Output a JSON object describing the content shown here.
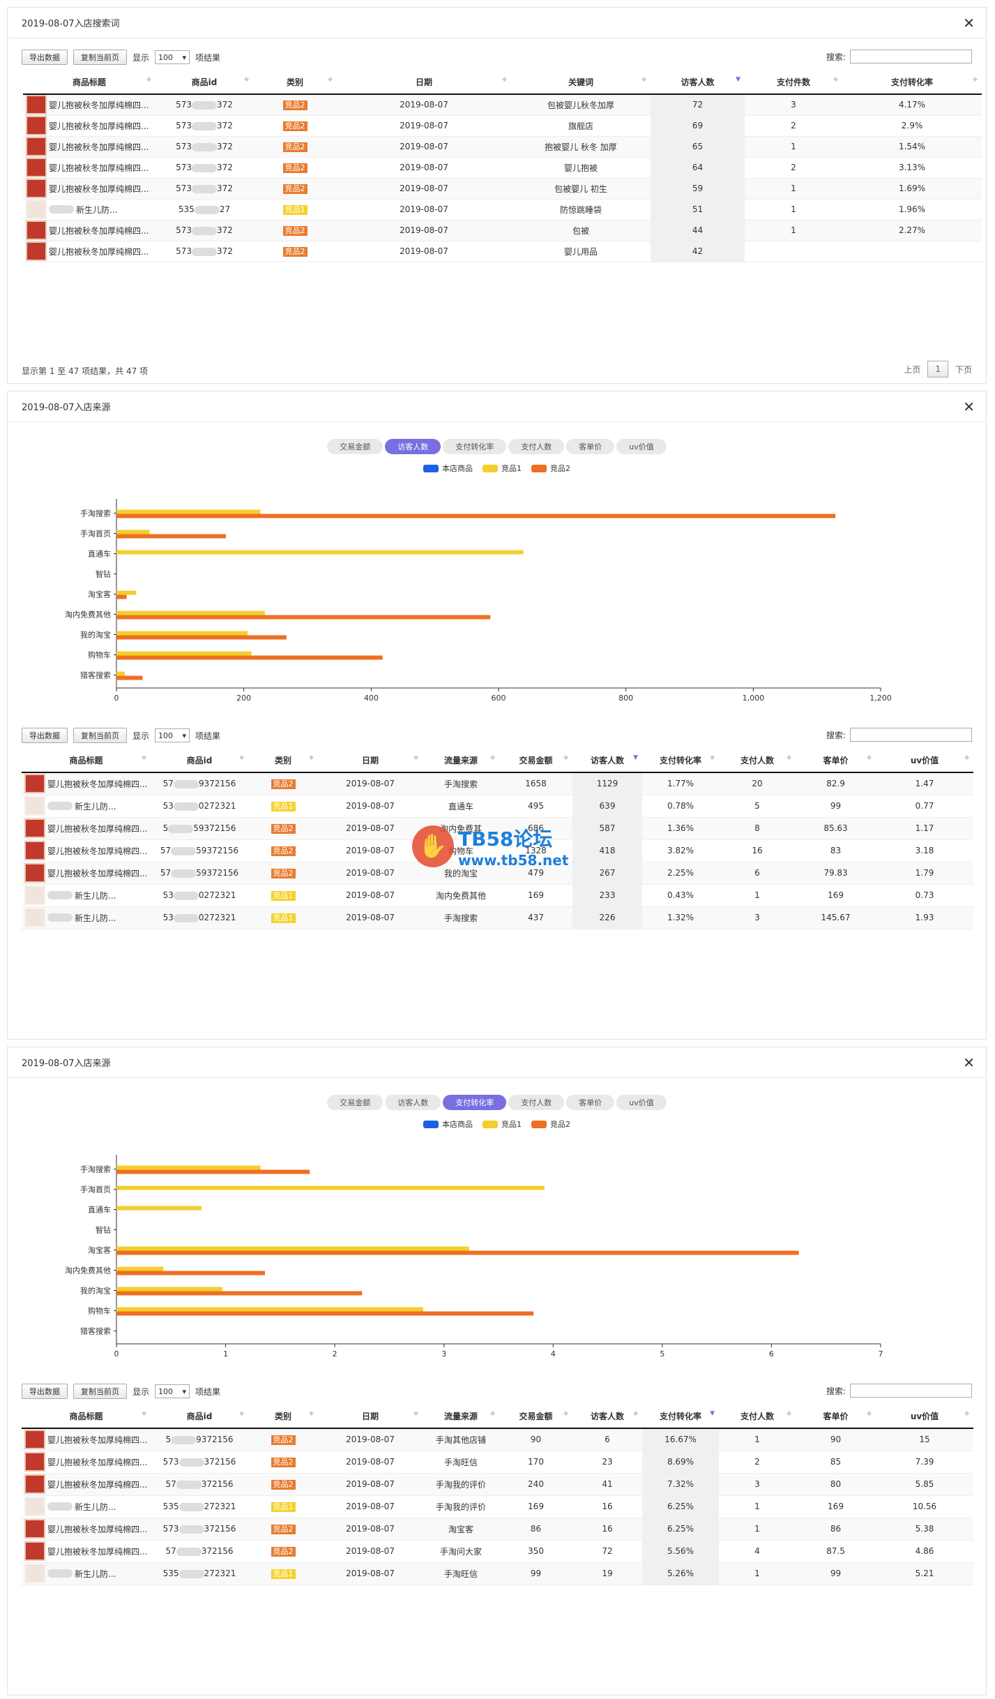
{
  "panel1": {
    "title": "2019-08-07入店搜索词",
    "export_btn": "导出数据",
    "copy_btn": "复制当前页",
    "show_label": "显示",
    "page_size": "100",
    "result_label": "项结果",
    "search_label": "搜索:",
    "headers": [
      "商品标题",
      "商品id",
      "类别",
      "日期",
      "关键词",
      "访客人数",
      "支付件数",
      "支付转化率"
    ],
    "rows": [
      {
        "thumb": "red",
        "title": "婴儿抱被秋冬加厚纯棉四...",
        "id": "573",
        "id2": "372",
        "cat": "竞品2",
        "cat_color": "o",
        "date": "2019-08-07",
        "kw": "包被婴儿秋冬加厚",
        "v": "72",
        "pay": "3",
        "cr": "4.17%"
      },
      {
        "thumb": "red",
        "title": "婴儿抱被秋冬加厚纯棉四...",
        "id": "573",
        "id2": "372",
        "cat": "竞品2",
        "cat_color": "o",
        "date": "2019-08-07",
        "kw": "旗舰店",
        "v": "69",
        "pay": "2",
        "cr": "2.9%"
      },
      {
        "thumb": "red",
        "title": "婴儿抱被秋冬加厚纯棉四...",
        "id": "573",
        "id2": "372",
        "cat": "竞品2",
        "cat_color": "o",
        "date": "2019-08-07",
        "kw": "抱被婴儿 秋冬 加厚",
        "v": "65",
        "pay": "1",
        "cr": "1.54%"
      },
      {
        "thumb": "red",
        "title": "婴儿抱被秋冬加厚纯棉四...",
        "id": "573",
        "id2": "372",
        "cat": "竞品2",
        "cat_color": "o",
        "date": "2019-08-07",
        "kw": "婴儿抱被",
        "v": "64",
        "pay": "2",
        "cr": "3.13%"
      },
      {
        "thumb": "red",
        "title": "婴儿抱被秋冬加厚纯棉四...",
        "id": "573",
        "id2": "372",
        "cat": "竞品2",
        "cat_color": "o",
        "date": "2019-08-07",
        "kw": "包被婴儿 初生",
        "v": "59",
        "pay": "1",
        "cr": "1.69%"
      },
      {
        "thumb": "beige",
        "title": "新生儿防...",
        "id": "535",
        "id2": "27",
        "cat": "竞品1",
        "cat_color": "y",
        "date": "2019-08-07",
        "kw": "防惊跳睡袋",
        "v": "51",
        "pay": "1",
        "cr": "1.96%"
      },
      {
        "thumb": "red",
        "title": "婴儿抱被秋冬加厚纯棉四...",
        "id": "573",
        "id2": "372",
        "cat": "竞品2",
        "cat_color": "o",
        "date": "2019-08-07",
        "kw": "包被",
        "v": "44",
        "pay": "1",
        "cr": "2.27%"
      },
      {
        "thumb": "red",
        "title": "婴儿抱被秋冬加厚纯棉四...",
        "id": "573",
        "id2": "372",
        "cat": "竞品2",
        "cat_color": "o",
        "date": "2019-08-07",
        "kw": "婴儿用品",
        "v": "42",
        "pay": "",
        "cr": ""
      }
    ],
    "footer": "显示第 1 至 47 项结果，共 47 项",
    "prev": "上页",
    "page": "1",
    "next": "下页"
  },
  "panel2": {
    "title": "2019-08-07入店来源",
    "tabs": [
      "交易金额",
      "访客人数",
      "支付转化率",
      "支付人数",
      "客单价",
      "uv价值"
    ],
    "active_tab": 1,
    "legend": [
      "本店商品",
      "竞品1",
      "竞品2"
    ],
    "export_btn": "导出数据",
    "copy_btn": "复制当前页",
    "show_label": "显示",
    "page_size": "100",
    "result_label": "项结果",
    "search_label": "搜索:",
    "headers": [
      "商品标题",
      "商品id",
      "类别",
      "日期",
      "流量来源",
      "交易金额",
      "访客人数",
      "支付转化率",
      "支付人数",
      "客单价",
      "uv价值"
    ],
    "rows": [
      {
        "thumb": "red",
        "title": "婴儿抱被秋冬加厚纯棉四...",
        "id": "57",
        "id2": "9372156",
        "cat": "竞品2",
        "cat_color": "o",
        "date": "2019-08-07",
        "src": "手淘搜索",
        "amt": "1658",
        "v": "1129",
        "cr": "1.77%",
        "pay": "20",
        "price": "82.9",
        "uv": "1.47"
      },
      {
        "thumb": "beige",
        "title": "新生儿防...",
        "id": "53",
        "id2": "0272321",
        "cat": "竞品1",
        "cat_color": "y",
        "date": "2019-08-07",
        "src": "直通车",
        "amt": "495",
        "v": "639",
        "cr": "0.78%",
        "pay": "5",
        "price": "99",
        "uv": "0.77"
      },
      {
        "thumb": "red",
        "title": "婴儿抱被秋冬加厚纯棉四...",
        "id": "5",
        "id2": "59372156",
        "cat": "竞品2",
        "cat_color": "o",
        "date": "2019-08-07",
        "src": "淘内免费其",
        "amt": "686",
        "v": "587",
        "cr": "1.36%",
        "pay": "8",
        "price": "85.63",
        "uv": "1.17"
      },
      {
        "thumb": "red",
        "title": "婴儿抱被秋冬加厚纯棉四...",
        "id": "57",
        "id2": "59372156",
        "cat": "竞品2",
        "cat_color": "o",
        "date": "2019-08-07",
        "src": "购物车",
        "amt": "1328",
        "v": "418",
        "cr": "3.82%",
        "pay": "16",
        "price": "83",
        "uv": "3.18"
      },
      {
        "thumb": "red",
        "title": "婴儿抱被秋冬加厚纯棉四...",
        "id": "57",
        "id2": "59372156",
        "cat": "竞品2",
        "cat_color": "o",
        "date": "2019-08-07",
        "src": "我的淘宝",
        "amt": "479",
        "v": "267",
        "cr": "2.25%",
        "pay": "6",
        "price": "79.83",
        "uv": "1.79"
      },
      {
        "thumb": "beige",
        "title": "新生儿防...",
        "id": "53",
        "id2": "0272321",
        "cat": "竞品1",
        "cat_color": "y",
        "date": "2019-08-07",
        "src": "淘内免费其他",
        "amt": "169",
        "v": "233",
        "cr": "0.43%",
        "pay": "1",
        "price": "169",
        "uv": "0.73"
      },
      {
        "thumb": "beige",
        "title": "新生儿防...",
        "id": "53",
        "id2": "0272321",
        "cat": "竞品1",
        "cat_color": "y",
        "date": "2019-08-07",
        "src": "手淘搜索",
        "amt": "437",
        "v": "226",
        "cr": "1.32%",
        "pay": "3",
        "price": "145.67",
        "uv": "1.93"
      }
    ],
    "watermark_1": "TB58论坛",
    "watermark_2": "www.tb58.net"
  },
  "panel3": {
    "title": "2019-08-07入店来源",
    "tabs": [
      "交易金额",
      "访客人数",
      "支付转化率",
      "支付人数",
      "客单价",
      "uv价值"
    ],
    "active_tab": 2,
    "legend": [
      "本店商品",
      "竞品1",
      "竞品2"
    ],
    "export_btn": "导出数据",
    "copy_btn": "复制当前页",
    "show_label": "显示",
    "page_size": "100",
    "result_label": "项结果",
    "search_label": "搜索:",
    "headers": [
      "商品标题",
      "商品id",
      "类别",
      "日期",
      "流量来源",
      "交易金额",
      "访客人数",
      "支付转化率",
      "支付人数",
      "客单价",
      "uv价值"
    ],
    "rows": [
      {
        "thumb": "red",
        "title": "婴儿抱被秋冬加厚纯棉四...",
        "id": "5",
        "id2": "9372156",
        "cat": "竞品2",
        "cat_color": "o",
        "date": "2019-08-07",
        "src": "手淘其他店铺",
        "amt": "90",
        "v": "6",
        "cr": "16.67%",
        "pay": "1",
        "price": "90",
        "uv": "15"
      },
      {
        "thumb": "red",
        "title": "婴儿抱被秋冬加厚纯棉四...",
        "id": "573",
        "id2": "372156",
        "cat": "竞品2",
        "cat_color": "o",
        "date": "2019-08-07",
        "src": "手淘旺信",
        "amt": "170",
        "v": "23",
        "cr": "8.69%",
        "pay": "2",
        "price": "85",
        "uv": "7.39"
      },
      {
        "thumb": "red",
        "title": "婴儿抱被秋冬加厚纯棉四...",
        "id": "57",
        "id2": "372156",
        "cat": "竞品2",
        "cat_color": "o",
        "date": "2019-08-07",
        "src": "手淘我的评价",
        "amt": "240",
        "v": "41",
        "cr": "7.32%",
        "pay": "3",
        "price": "80",
        "uv": "5.85"
      },
      {
        "thumb": "beige",
        "title": "新生儿防...",
        "id": "535",
        "id2": "272321",
        "cat": "竞品1",
        "cat_color": "y",
        "date": "2019-08-07",
        "src": "手淘我的评价",
        "amt": "169",
        "v": "16",
        "cr": "6.25%",
        "pay": "1",
        "price": "169",
        "uv": "10.56"
      },
      {
        "thumb": "red",
        "title": "婴儿抱被秋冬加厚纯棉四...",
        "id": "573",
        "id2": "372156",
        "cat": "竞品2",
        "cat_color": "o",
        "date": "2019-08-07",
        "src": "淘宝客",
        "amt": "86",
        "v": "16",
        "cr": "6.25%",
        "pay": "1",
        "price": "86",
        "uv": "5.38"
      },
      {
        "thumb": "red",
        "title": "婴儿抱被秋冬加厚纯棉四...",
        "id": "57",
        "id2": "372156",
        "cat": "竞品2",
        "cat_color": "o",
        "date": "2019-08-07",
        "src": "手淘问大家",
        "amt": "350",
        "v": "72",
        "cr": "5.56%",
        "pay": "4",
        "price": "87.5",
        "uv": "4.86"
      },
      {
        "thumb": "beige",
        "title": "新生儿防...",
        "id": "535",
        "id2": "272321",
        "cat": "竞品1",
        "cat_color": "y",
        "date": "2019-08-07",
        "src": "手淘旺信",
        "amt": "99",
        "v": "19",
        "cr": "5.26%",
        "pay": "1",
        "price": "99",
        "uv": "5.21"
      }
    ]
  },
  "colors": {
    "own": "#1f5fe0",
    "comp1": "#f2cf2c",
    "comp2": "#ee6f22",
    "active_tab": "#7a6fe0"
  },
  "chart_data": [
    {
      "type": "bar",
      "orientation": "horizontal",
      "categories": [
        "手淘搜索",
        "手淘首页",
        "直通车",
        "智钻",
        "淘宝客",
        "淘内免费其他",
        "我的淘宝",
        "购物车",
        "猎客搜索"
      ],
      "series": [
        {
          "name": "本店商品",
          "values": [
            0,
            0,
            0,
            0,
            0,
            0,
            0,
            0,
            0
          ]
        },
        {
          "name": "竞品1",
          "values": [
            226,
            52,
            639,
            0,
            31,
            233,
            206,
            212,
            13
          ]
        },
        {
          "name": "竞品2",
          "values": [
            1129,
            172,
            0,
            0,
            16,
            587,
            267,
            418,
            41
          ]
        }
      ],
      "xlim": [
        0,
        1200
      ],
      "ticks": [
        0,
        200,
        400,
        600,
        800,
        1000,
        1200
      ],
      "tick_labels": [
        "0",
        "200",
        "400",
        "600",
        "800",
        "1,000",
        "1,200"
      ]
    },
    {
      "type": "bar",
      "orientation": "horizontal",
      "categories": [
        "手淘搜索",
        "手淘首页",
        "直通车",
        "智钻",
        "淘宝客",
        "淘内免费其他",
        "我的淘宝",
        "购物车",
        "猎客搜索"
      ],
      "series": [
        {
          "name": "本店商品",
          "values": [
            0,
            0,
            0,
            0,
            0,
            0,
            0,
            0,
            0
          ]
        },
        {
          "name": "竞品1",
          "values": [
            1.32,
            3.92,
            0.78,
            0,
            3.23,
            0.43,
            0.97,
            2.81,
            0
          ]
        },
        {
          "name": "竞品2",
          "values": [
            1.77,
            0,
            0,
            0,
            6.25,
            1.36,
            2.25,
            3.82,
            0
          ]
        }
      ],
      "xlim": [
        0,
        7
      ],
      "ticks": [
        0,
        1,
        2,
        3,
        4,
        5,
        6,
        7
      ],
      "tick_labels": [
        "0",
        "1",
        "2",
        "3",
        "4",
        "5",
        "6",
        "7"
      ]
    }
  ]
}
